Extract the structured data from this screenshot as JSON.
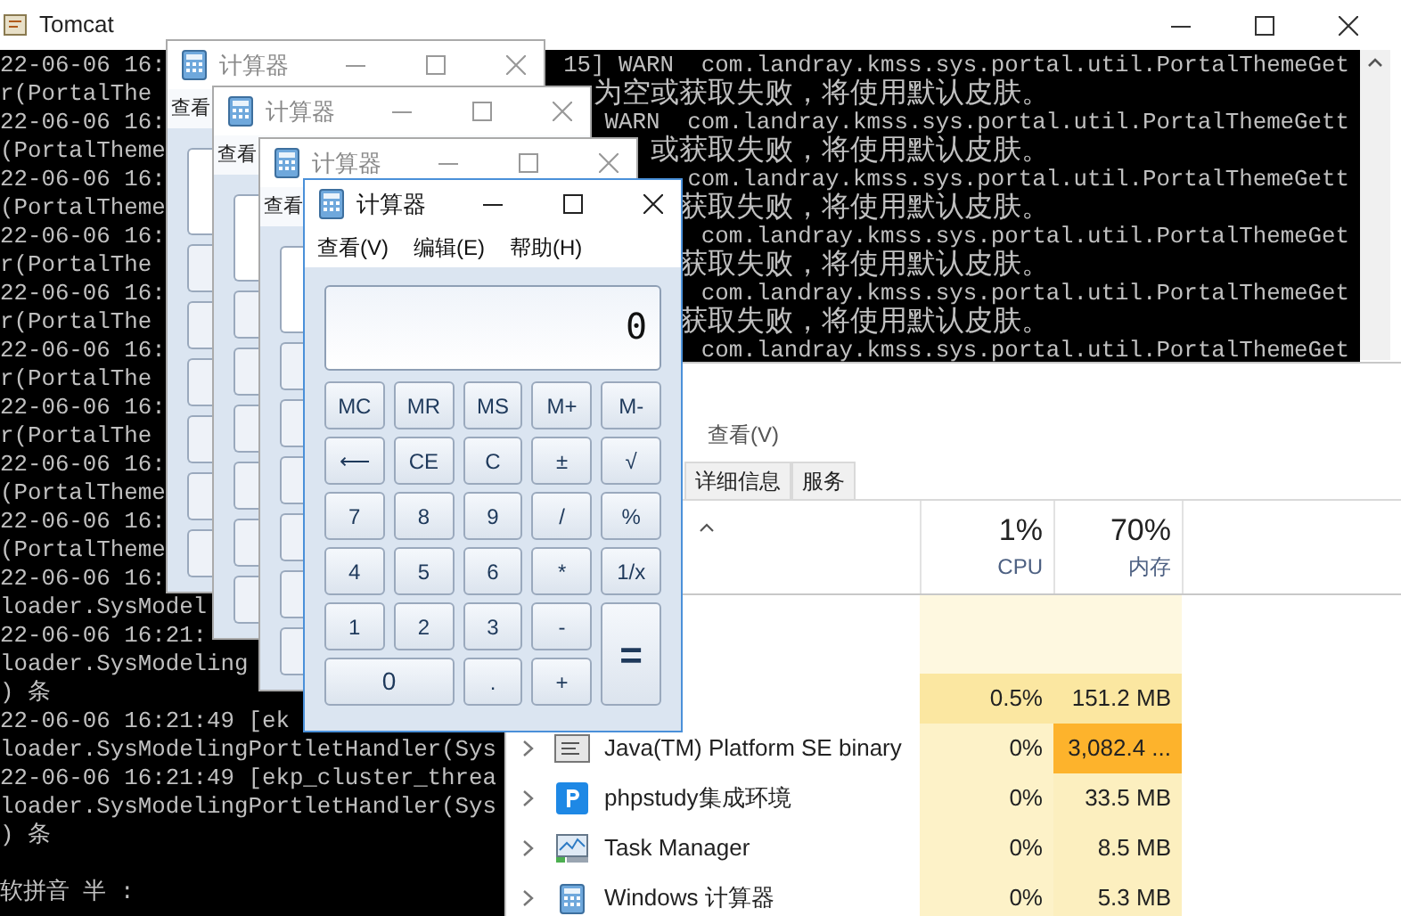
{
  "console_window": {
    "title": "Tomcat",
    "lines": [
      {
        "kind": "log",
        "left": "22-06-06 16:",
        "right": "15] WARN  com.landray.kmss.sys.portal.util.PortalThemeGet"
      },
      {
        "kind": "message",
        "left": "r(PortalThe",
        "right": "为空或获取失败，将使用默认皮肤。"
      },
      {
        "kind": "log",
        "left": "22-06-06 16:",
        "right": "WARN  com.landray.kmss.sys.portal.util.PortalThemeGett"
      },
      {
        "kind": "message",
        "left": "(PortalTheme",
        "right": "或获取失败，将使用默认皮肤。"
      },
      {
        "kind": "log",
        "left": "22-06-06 16:",
        "right": "com.landray.kmss.sys.portal.util.PortalThemeGett"
      },
      {
        "kind": "message",
        "left": "(PortalTheme",
        "right": "获取失败，将使用默认皮肤。"
      },
      {
        "kind": "log",
        "left": "22-06-06 16:",
        "right": "com.landray.kmss.sys.portal.util.PortalThemeGet"
      },
      {
        "kind": "message",
        "left": "r(PortalThe",
        "right": "获取失败，将使用默认皮肤。"
      },
      {
        "kind": "log",
        "left": "22-06-06 16:",
        "right": "com.landray.kmss.sys.portal.util.PortalThemeGet"
      },
      {
        "kind": "message",
        "left": "r(PortalThe",
        "right": "获取失败，将使用默认皮肤。"
      },
      {
        "kind": "log",
        "left": "22-06-06 16:",
        "right": "com.landray.kmss.sys.portal.util.PortalThemeGet"
      },
      {
        "kind": "plain",
        "left": "r(PortalThe"
      },
      {
        "kind": "plain",
        "left": "22-06-06 16:"
      },
      {
        "kind": "plain",
        "left": "r(PortalThe"
      },
      {
        "kind": "plain",
        "left": "22-06-06 16:"
      },
      {
        "kind": "plain",
        "left": "(PortalTheme"
      },
      {
        "kind": "plain",
        "left": "22-06-06 16:"
      },
      {
        "kind": "plain",
        "left": "(PortalTheme"
      },
      {
        "kind": "plain",
        "left": "22-06-06 16:"
      },
      {
        "kind": "plain",
        "left": "loader.SysModel"
      },
      {
        "kind": "plain",
        "left": "22-06-06 16:21:"
      },
      {
        "kind": "plain",
        "left": "loader.SysModeling"
      },
      {
        "kind": "plain",
        "left": ") 条"
      },
      {
        "kind": "plain",
        "left": "22-06-06 16:21:49 [ek"
      },
      {
        "kind": "plain",
        "left": "loader.SysModelingPortletHandler(Sys"
      },
      {
        "kind": "plain",
        "left": "22-06-06 16:21:49 [ekp_cluster_threa"
      },
      {
        "kind": "plain",
        "left": "loader.SysModelingPortletHandler(Sys"
      },
      {
        "kind": "plain",
        "left": ") 条"
      },
      {
        "kind": "blank"
      },
      {
        "kind": "plain",
        "left": "软拼音 半 :"
      }
    ]
  },
  "task_manager": {
    "menu": "查看(V)",
    "tabs": [
      {
        "label": "详细信息",
        "selected": false
      },
      {
        "label": "服务",
        "selected": false
      }
    ],
    "columns": [
      {
        "value": "1%",
        "label": "CPU"
      },
      {
        "value": "70%",
        "label": "内存"
      }
    ],
    "rows": [
      {
        "kind": "group"
      },
      {
        "kind": "service",
        "cpu": "0.5%",
        "memory": "151.2 MB",
        "color": "#fbe7a1"
      },
      {
        "kind": "console",
        "name": "Java(TM) Platform SE binary",
        "cpu": "0%",
        "memory": "3,082.4 ...",
        "color": "#fdb32c"
      },
      {
        "kind": "badge",
        "name": "phpstudy集成环境",
        "cpu": "0%",
        "memory": "33.5 MB",
        "color": "#fcefbf"
      },
      {
        "kind": "monitor",
        "name": "Task Manager",
        "cpu": "0%",
        "memory": "8.5 MB",
        "color": "#fcefbf"
      },
      {
        "kind": "calculator",
        "name": "Windows 计算器",
        "cpu": "0%",
        "memory": "5.3 MB",
        "color": "#fcefbf"
      }
    ]
  },
  "background_calculators": [
    {
      "title": "计算器",
      "menu": "查看"
    },
    {
      "title": "计算器",
      "menu": "查看"
    },
    {
      "title": "计算器",
      "menu": "查看"
    }
  ],
  "calculator": {
    "title": "计算器",
    "menu": [
      "查看(V)",
      "编辑(E)",
      "帮助(H)"
    ],
    "display": "0",
    "buttons": [
      {
        "label": "MC",
        "kind": "normal"
      },
      {
        "label": "MR",
        "kind": "normal"
      },
      {
        "label": "MS",
        "kind": "normal"
      },
      {
        "label": "M+",
        "kind": "normal"
      },
      {
        "label": "M-",
        "kind": "normal"
      },
      {
        "label": "⟵",
        "kind": "normal"
      },
      {
        "label": "CE",
        "kind": "normal"
      },
      {
        "label": "C",
        "kind": "normal"
      },
      {
        "label": "±",
        "kind": "normal"
      },
      {
        "label": "√",
        "kind": "normal"
      },
      {
        "label": "7",
        "kind": "normal"
      },
      {
        "label": "8",
        "kind": "normal"
      },
      {
        "label": "9",
        "kind": "normal"
      },
      {
        "label": "/",
        "kind": "normal"
      },
      {
        "label": "%",
        "kind": "normal"
      },
      {
        "label": "4",
        "kind": "normal"
      },
      {
        "label": "5",
        "kind": "normal"
      },
      {
        "label": "6",
        "kind": "normal"
      },
      {
        "label": "*",
        "kind": "normal"
      },
      {
        "label": "1/x",
        "kind": "normal"
      },
      {
        "label": "1",
        "kind": "normal"
      },
      {
        "label": "2",
        "kind": "normal"
      },
      {
        "label": "3",
        "kind": "normal"
      },
      {
        "label": "-",
        "kind": "normal"
      },
      {
        "label": "=",
        "kind": "tall"
      },
      {
        "label": "0",
        "kind": "wide"
      },
      {
        "label": ".",
        "kind": "normal"
      },
      {
        "label": "+",
        "kind": "normal"
      }
    ]
  }
}
